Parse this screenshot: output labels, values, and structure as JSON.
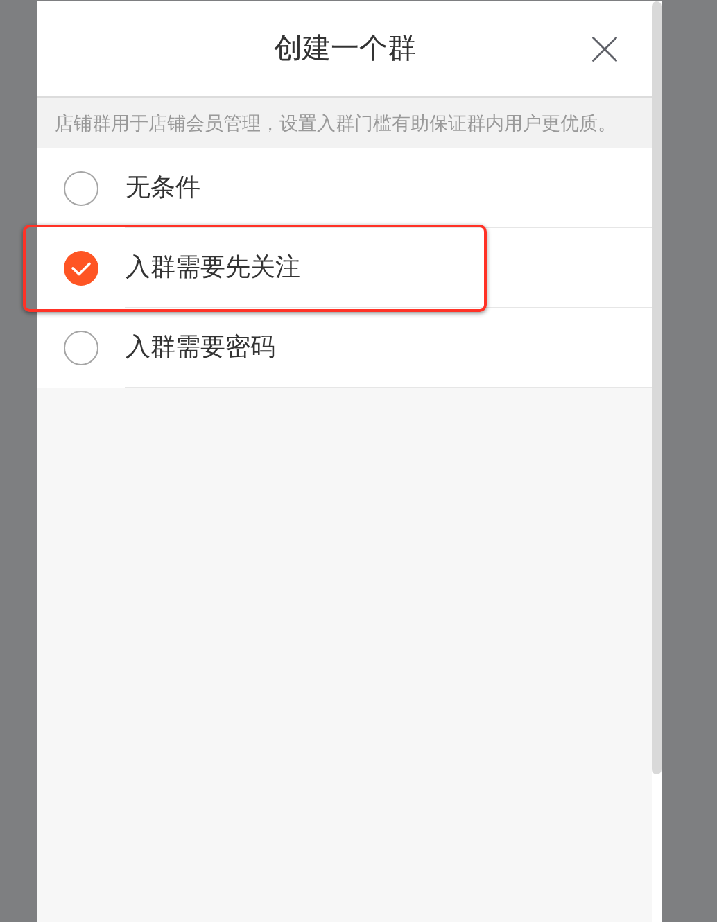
{
  "dialog": {
    "title": "创建一个群"
  },
  "notice": "店铺群用于店铺会员管理，设置入群门槛有助保证群内用户更优质。",
  "options": [
    {
      "label": "无条件",
      "selected": false,
      "highlighted": false
    },
    {
      "label": "入群需要先关注",
      "selected": true,
      "highlighted": true
    },
    {
      "label": "入群需要密码",
      "selected": false,
      "highlighted": false
    }
  ]
}
